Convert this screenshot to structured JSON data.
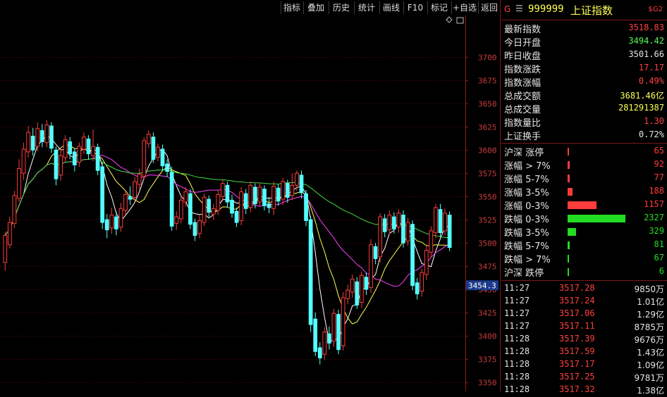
{
  "toolbar": {
    "buttons": [
      "指标",
      "叠加",
      "历史",
      "统计",
      "画线",
      "F10",
      "标记",
      "+自选",
      "返回"
    ]
  },
  "header": {
    "g_label": "G",
    "menu_glyph": "☰",
    "code": "999999",
    "name": "上证指数",
    "badge": "$G2"
  },
  "colors": {
    "up": "#ff3c3c",
    "down": "#54ffff",
    "ma5": "#ffffff",
    "ma10": "#ffff55",
    "ma20": "#ff44ff",
    "ma60": "#44dd44",
    "grid": "#5a1010"
  },
  "quote": [
    {
      "label": "最新指数",
      "value": "3518.83",
      "color": "#ff4040"
    },
    {
      "label": "今日开盘",
      "value": "3494.42",
      "color": "#54ff54"
    },
    {
      "label": "昨日收盘",
      "value": "3501.66",
      "color": "#e6e6e6"
    },
    {
      "label": "指数涨跌",
      "value": "17.17",
      "color": "#ff4040"
    },
    {
      "label": "指数涨幅",
      "value": "0.49%",
      "color": "#ff4040"
    },
    {
      "label": "总成交额",
      "value": "3681.46亿",
      "color": "#ffff55"
    },
    {
      "label": "总成交量",
      "value": "281291387",
      "color": "#ffff55"
    },
    {
      "label": "指数量比",
      "value": "1.30",
      "color": "#ff4040"
    },
    {
      "label": "上证换手",
      "value": "0.72%",
      "color": "#e6e6e6"
    }
  ],
  "distribution": [
    {
      "label": "沪深 涨停",
      "value": "65",
      "color": "#ff3c3c",
      "count": 65
    },
    {
      "label": "涨幅 > 7%",
      "value": "92",
      "color": "#ff3c3c",
      "count": 92
    },
    {
      "label": "涨幅 5-7%",
      "value": "77",
      "color": "#ff3c3c",
      "count": 77
    },
    {
      "label": "涨幅 3-5%",
      "value": "188",
      "color": "#ff3c3c",
      "count": 188
    },
    {
      "label": "涨幅 0-3%",
      "value": "1157",
      "color": "#ff3c3c",
      "count": 1157
    },
    {
      "label": "跌幅 0-3%",
      "value": "2327",
      "color": "#22dd22",
      "count": 2327
    },
    {
      "label": "跌幅 3-5%",
      "value": "329",
      "color": "#22dd22",
      "count": 329
    },
    {
      "label": "跌幅 5-7%",
      "value": "81",
      "color": "#22dd22",
      "count": 81
    },
    {
      "label": "跌幅 > 7%",
      "value": "67",
      "color": "#22dd22",
      "count": 67
    },
    {
      "label": "沪深 跌停",
      "value": "6",
      "color": "#22dd22",
      "count": 6
    }
  ],
  "ticks": [
    {
      "time": "11:27",
      "price": "3517.28",
      "vol": "9850万"
    },
    {
      "time": "11:27",
      "price": "3517.24",
      "vol": "1.01亿"
    },
    {
      "time": "11:27",
      "price": "3517.06",
      "vol": "1.29亿"
    },
    {
      "time": "11:27",
      "price": "3517.11",
      "vol": "8785万"
    },
    {
      "time": "11:28",
      "price": "3517.39",
      "vol": "9676万"
    },
    {
      "time": "11:28",
      "price": "3517.59",
      "vol": "1.43亿"
    },
    {
      "time": "11:28",
      "price": "3517.17",
      "vol": "1.09亿"
    },
    {
      "time": "11:28",
      "price": "3517.25",
      "vol": "9781万"
    },
    {
      "time": "11:28",
      "price": "3517.32",
      "vol": "1.38亿"
    }
  ],
  "chart_data": {
    "type": "candlestick",
    "y_axis_ticks": [
      3350,
      3375,
      3400,
      3425,
      3450,
      3475,
      3500,
      3525,
      3550,
      3575,
      3600,
      3625,
      3650,
      3675,
      3700
    ],
    "ylim": [
      3340,
      3745
    ],
    "crosshair_label": "3454.3",
    "candles": [
      [
        3479,
        3508,
        3470,
        3512
      ],
      [
        3498,
        3522,
        3494,
        3528
      ],
      [
        3521,
        3551,
        3516,
        3556
      ],
      [
        3548,
        3580,
        3544,
        3590
      ],
      [
        3575,
        3601,
        3568,
        3608
      ],
      [
        3598,
        3619,
        3592,
        3626
      ],
      [
        3615,
        3600,
        3594,
        3624
      ],
      [
        3604,
        3623,
        3599,
        3630
      ],
      [
        3621,
        3609,
        3603,
        3628
      ],
      [
        3608,
        3627,
        3603,
        3632
      ],
      [
        3626,
        3602,
        3597,
        3630
      ],
      [
        3600,
        3569,
        3562,
        3604
      ],
      [
        3573,
        3594,
        3567,
        3601
      ],
      [
        3592,
        3611,
        3587,
        3616
      ],
      [
        3609,
        3596,
        3590,
        3614
      ],
      [
        3598,
        3584,
        3577,
        3602
      ],
      [
        3587,
        3604,
        3582,
        3608
      ],
      [
        3601,
        3614,
        3596,
        3619
      ],
      [
        3612,
        3596,
        3590,
        3616
      ],
      [
        3594,
        3604,
        3588,
        3622
      ],
      [
        3603,
        3578,
        3573,
        3607
      ],
      [
        3582,
        3522,
        3515,
        3587
      ],
      [
        3525,
        3514,
        3505,
        3531
      ],
      [
        3516,
        3530,
        3510,
        3538
      ],
      [
        3528,
        3515,
        3508,
        3534
      ],
      [
        3517,
        3537,
        3512,
        3543
      ],
      [
        3535,
        3552,
        3530,
        3556
      ],
      [
        3550,
        3547,
        3541,
        3561
      ],
      [
        3549,
        3566,
        3544,
        3571
      ],
      [
        3563,
        3574,
        3558,
        3580
      ],
      [
        3572,
        3610,
        3568,
        3614
      ],
      [
        3607,
        3617,
        3602,
        3621
      ],
      [
        3614,
        3590,
        3586,
        3619
      ],
      [
        3592,
        3603,
        3588,
        3607
      ],
      [
        3601,
        3583,
        3578,
        3606
      ],
      [
        3585,
        3577,
        3571,
        3590
      ],
      [
        3576,
        3518,
        3513,
        3582
      ],
      [
        3521,
        3528,
        3514,
        3534
      ],
      [
        3526,
        3546,
        3521,
        3551
      ],
      [
        3544,
        3555,
        3539,
        3560
      ],
      [
        3553,
        3520,
        3515,
        3558
      ],
      [
        3522,
        3508,
        3502,
        3526
      ],
      [
        3510,
        3524,
        3505,
        3530
      ],
      [
        3522,
        3549,
        3518,
        3553
      ],
      [
        3547,
        3533,
        3528,
        3551
      ],
      [
        3531,
        3537,
        3525,
        3542
      ],
      [
        3535,
        3552,
        3530,
        3557
      ],
      [
        3550,
        3564,
        3545,
        3568
      ],
      [
        3562,
        3544,
        3538,
        3566
      ],
      [
        3546,
        3532,
        3527,
        3552
      ],
      [
        3534,
        3522,
        3517,
        3538
      ],
      [
        3524,
        3555,
        3519,
        3560
      ],
      [
        3553,
        3537,
        3531,
        3558
      ],
      [
        3538,
        3562,
        3533,
        3566
      ],
      [
        3560,
        3542,
        3537,
        3564
      ],
      [
        3544,
        3560,
        3539,
        3565
      ],
      [
        3558,
        3540,
        3535,
        3562
      ],
      [
        3542,
        3538,
        3532,
        3549
      ],
      [
        3537,
        3561,
        3530,
        3566
      ],
      [
        3559,
        3545,
        3540,
        3563
      ],
      [
        3547,
        3566,
        3541,
        3570
      ],
      [
        3564,
        3549,
        3543,
        3568
      ],
      [
        3551,
        3562,
        3546,
        3575
      ],
      [
        3562,
        3575,
        3556,
        3578
      ],
      [
        3573,
        3554,
        3548,
        3578
      ],
      [
        3553,
        3524,
        3518,
        3557
      ],
      [
        3525,
        3412,
        3404,
        3529
      ],
      [
        3418,
        3383,
        3378,
        3425
      ],
      [
        3387,
        3376,
        3369,
        3393
      ],
      [
        3380,
        3404,
        3374,
        3409
      ],
      [
        3402,
        3392,
        3385,
        3410
      ],
      [
        3394,
        3424,
        3388,
        3429
      ],
      [
        3423,
        3385,
        3380,
        3428
      ],
      [
        3389,
        3441,
        3384,
        3447
      ],
      [
        3440,
        3449,
        3434,
        3455
      ],
      [
        3447,
        3461,
        3441,
        3466
      ],
      [
        3458,
        3433,
        3429,
        3463
      ],
      [
        3436,
        3465,
        3430,
        3469
      ],
      [
        3463,
        3450,
        3444,
        3468
      ],
      [
        3452,
        3498,
        3446,
        3504
      ],
      [
        3496,
        3483,
        3477,
        3500
      ],
      [
        3485,
        3528,
        3479,
        3532
      ],
      [
        3526,
        3512,
        3506,
        3531
      ],
      [
        3514,
        3530,
        3509,
        3535
      ],
      [
        3528,
        3515,
        3510,
        3533
      ],
      [
        3517,
        3532,
        3511,
        3536
      ],
      [
        3530,
        3500,
        3495,
        3535
      ],
      [
        3502,
        3522,
        3497,
        3527
      ],
      [
        3520,
        3454,
        3449,
        3524
      ],
      [
        3457,
        3445,
        3439,
        3462
      ],
      [
        3448,
        3468,
        3442,
        3472
      ],
      [
        3466,
        3492,
        3460,
        3497
      ],
      [
        3490,
        3513,
        3484,
        3518
      ],
      [
        3511,
        3538,
        3505,
        3542
      ],
      [
        3536,
        3511,
        3506,
        3542
      ],
      [
        3513,
        3532,
        3508,
        3537
      ],
      [
        3530,
        3495,
        3491,
        3534
      ]
    ]
  }
}
